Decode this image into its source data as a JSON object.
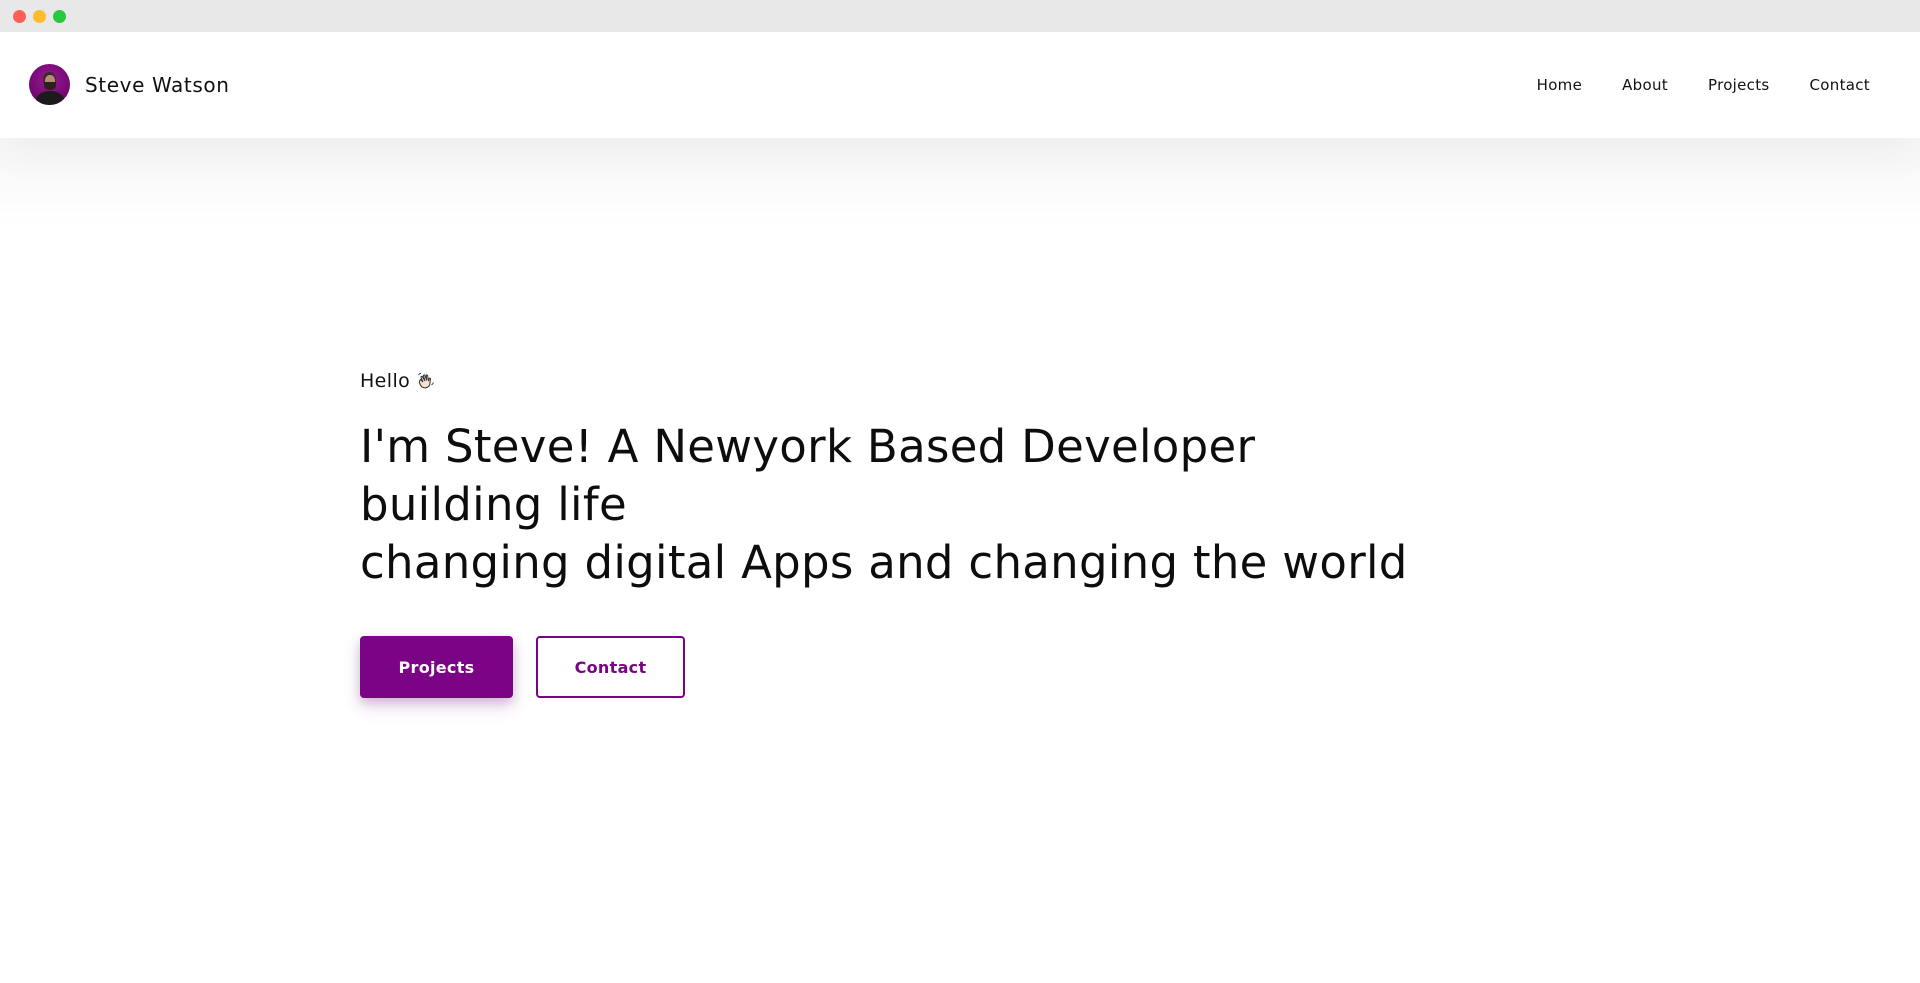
{
  "window": {
    "controls": [
      "close",
      "minimize",
      "maximize"
    ]
  },
  "brand": {
    "name": "Steve Watson",
    "avatar": "avatar-photo"
  },
  "nav": {
    "items": [
      "Home",
      "About",
      "Projects",
      "Contact"
    ]
  },
  "hero": {
    "greeting": "Hello",
    "greeting_icon": "waving-hand-icon",
    "headline_line1": "I'm Steve! A Newyork Based Developer building life",
    "headline_line2": "changing digital Apps and changing the world",
    "primary_button": "Projects",
    "secondary_button": "Contact"
  },
  "colors": {
    "accent": "#7b0385",
    "text": "#111111",
    "background": "#ffffff"
  }
}
